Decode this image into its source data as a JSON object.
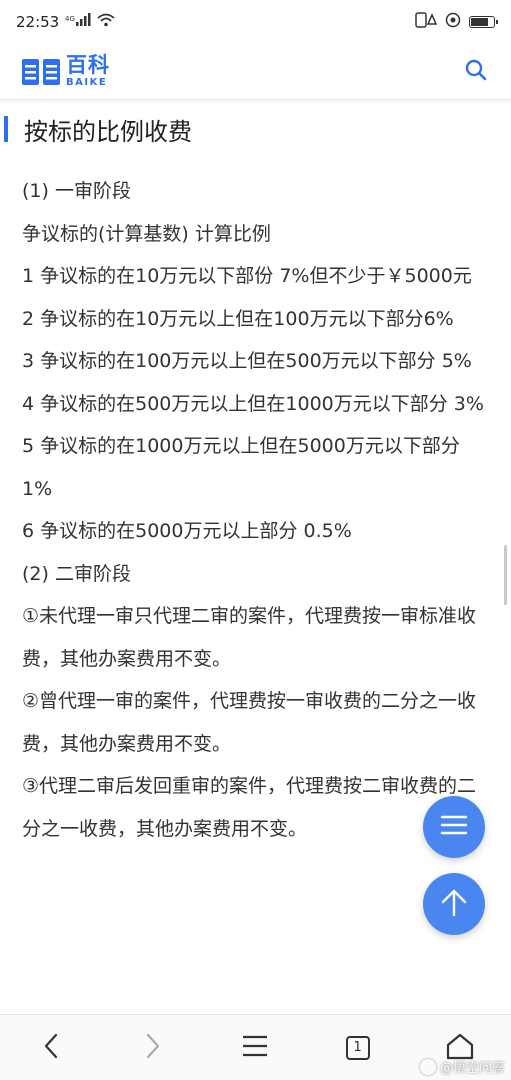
{
  "status_bar": {
    "time": "22:53",
    "signal_label": "4G",
    "icons_left": [
      "signal-icon",
      "wifi-icon"
    ],
    "icons_right": [
      "alarm-icon",
      "location-icon",
      "battery-icon"
    ]
  },
  "header": {
    "logo_cn": "百科",
    "logo_en": "BAIKE",
    "search_icon": "search-icon"
  },
  "section": {
    "title": "按标的比例收费"
  },
  "content": {
    "lines": [
      "(1) 一审阶段",
      "争议标的(计算基数) 计算比例",
      "1 争议标的在10万元以下部份 7%但不少于￥5000元",
      "2 争议标的在10万元以上但在100万元以下部分6%",
      "3 争议标的在100万元以上但在500万元以下部分 5%",
      "4 争议标的在500万元以上但在1000万元以下部分 3%",
      "5 争议标的在1000万元以上但在5000万元以下部分 1%",
      "6 争议标的在5000万元以上部分 0.5%",
      "(2) 二审阶段",
      "①未代理一审只代理二审的案件，代理费按一审标准收费，其他办案费用不变。",
      "②曾代理一审的案件，代理费按一审收费的二分之一收费，其他办案费用不变。",
      "③代理二审后发回重审的案件，代理费按二审收费的二分之一收费，其他办案费用不变。"
    ]
  },
  "fab": {
    "menu_icon": "list-icon",
    "top_icon": "arrow-up-icon"
  },
  "bottom_nav": {
    "items": [
      "back-icon",
      "forward-icon",
      "menu-icon",
      "tabs-icon",
      "home-icon"
    ],
    "tab_count": "1"
  },
  "watermark": {
    "text": "@悟空问答"
  },
  "colors": {
    "brand": "#2d6ff0",
    "fab": "#4a86f0",
    "text": "#333333"
  }
}
